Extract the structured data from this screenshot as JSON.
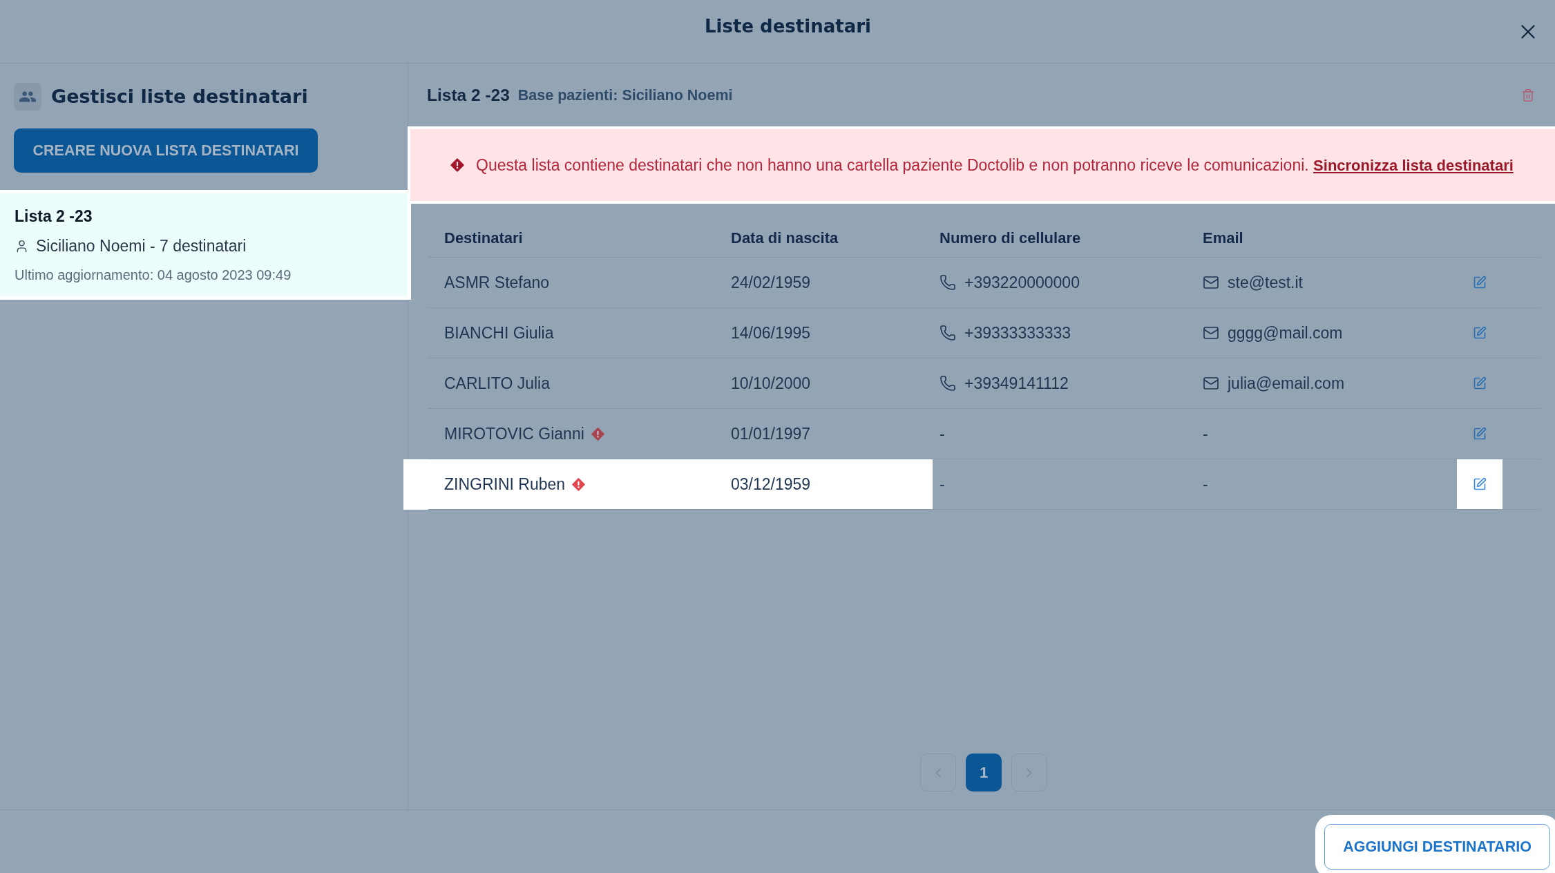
{
  "window": {
    "title": "Liste destinatari"
  },
  "sidebar": {
    "title": "Gestisci liste destinatari",
    "create_button": "CREARE NUOVA LISTA DESTINATARI",
    "lists": [
      {
        "title": "Lista 2 -23",
        "owner": "Siciliano Noemi - 7 destinatari",
        "updated": "Ultimo aggiornamento: 04 agosto 2023 09:49",
        "selected": true,
        "highlighted": true
      }
    ]
  },
  "detail": {
    "title": "Lista 2 -23",
    "subtitle": "Base pazienti: Siciliano Noemi",
    "alert": {
      "message": "Questa lista contiene destinatari che non hanno una cartella paziente Doctolib e non potranno riceve le comunicazioni.",
      "link": "Sincronizza lista destinatari",
      "highlighted": true
    },
    "table": {
      "columns": [
        "Destinatari",
        "Data di nascita",
        "Numero di cellulare",
        "Email"
      ],
      "rows": [
        {
          "name": "ASMR Stefano",
          "warning": false,
          "birth_date": "24/02/1959",
          "phone": {
            "text": "+393220000000",
            "kind": "number"
          },
          "email": {
            "text": "ste@test.it",
            "kind": "address"
          },
          "highlighted": false
        },
        {
          "name": "BIANCHI Giulia",
          "warning": false,
          "birth_date": "14/06/1995",
          "phone": {
            "text": "+39333333333",
            "kind": "number"
          },
          "email": {
            "text": "gggg@mail.com",
            "kind": "address"
          },
          "highlighted": false
        },
        {
          "name": "CARLITO Julia",
          "warning": false,
          "birth_date": "10/10/2000",
          "phone": {
            "text": "+39349141112",
            "kind": "number"
          },
          "email": {
            "text": "julia@email.com",
            "kind": "address"
          },
          "highlighted": false
        },
        {
          "name": "MIROTOVIC Gianni",
          "warning": true,
          "birth_date": "01/01/1997",
          "phone": {
            "text": "-",
            "kind": "missing"
          },
          "email": {
            "text": "-",
            "kind": "missing"
          },
          "highlighted": false
        },
        {
          "name": "ZINGRINI Ruben",
          "warning": true,
          "birth_date": "03/12/1959",
          "phone": {
            "text": "-",
            "kind": "missing"
          },
          "email": {
            "text": "-",
            "kind": "missing"
          },
          "highlighted": true
        }
      ]
    },
    "pagination": {
      "previous_disabled": true,
      "pages": [
        {
          "label": "1",
          "selected": true
        }
      ],
      "next_disabled": true
    }
  },
  "footer": {
    "add_button": {
      "label": "AGGIUNGI DESTINATARIO",
      "highlighted": true
    }
  }
}
